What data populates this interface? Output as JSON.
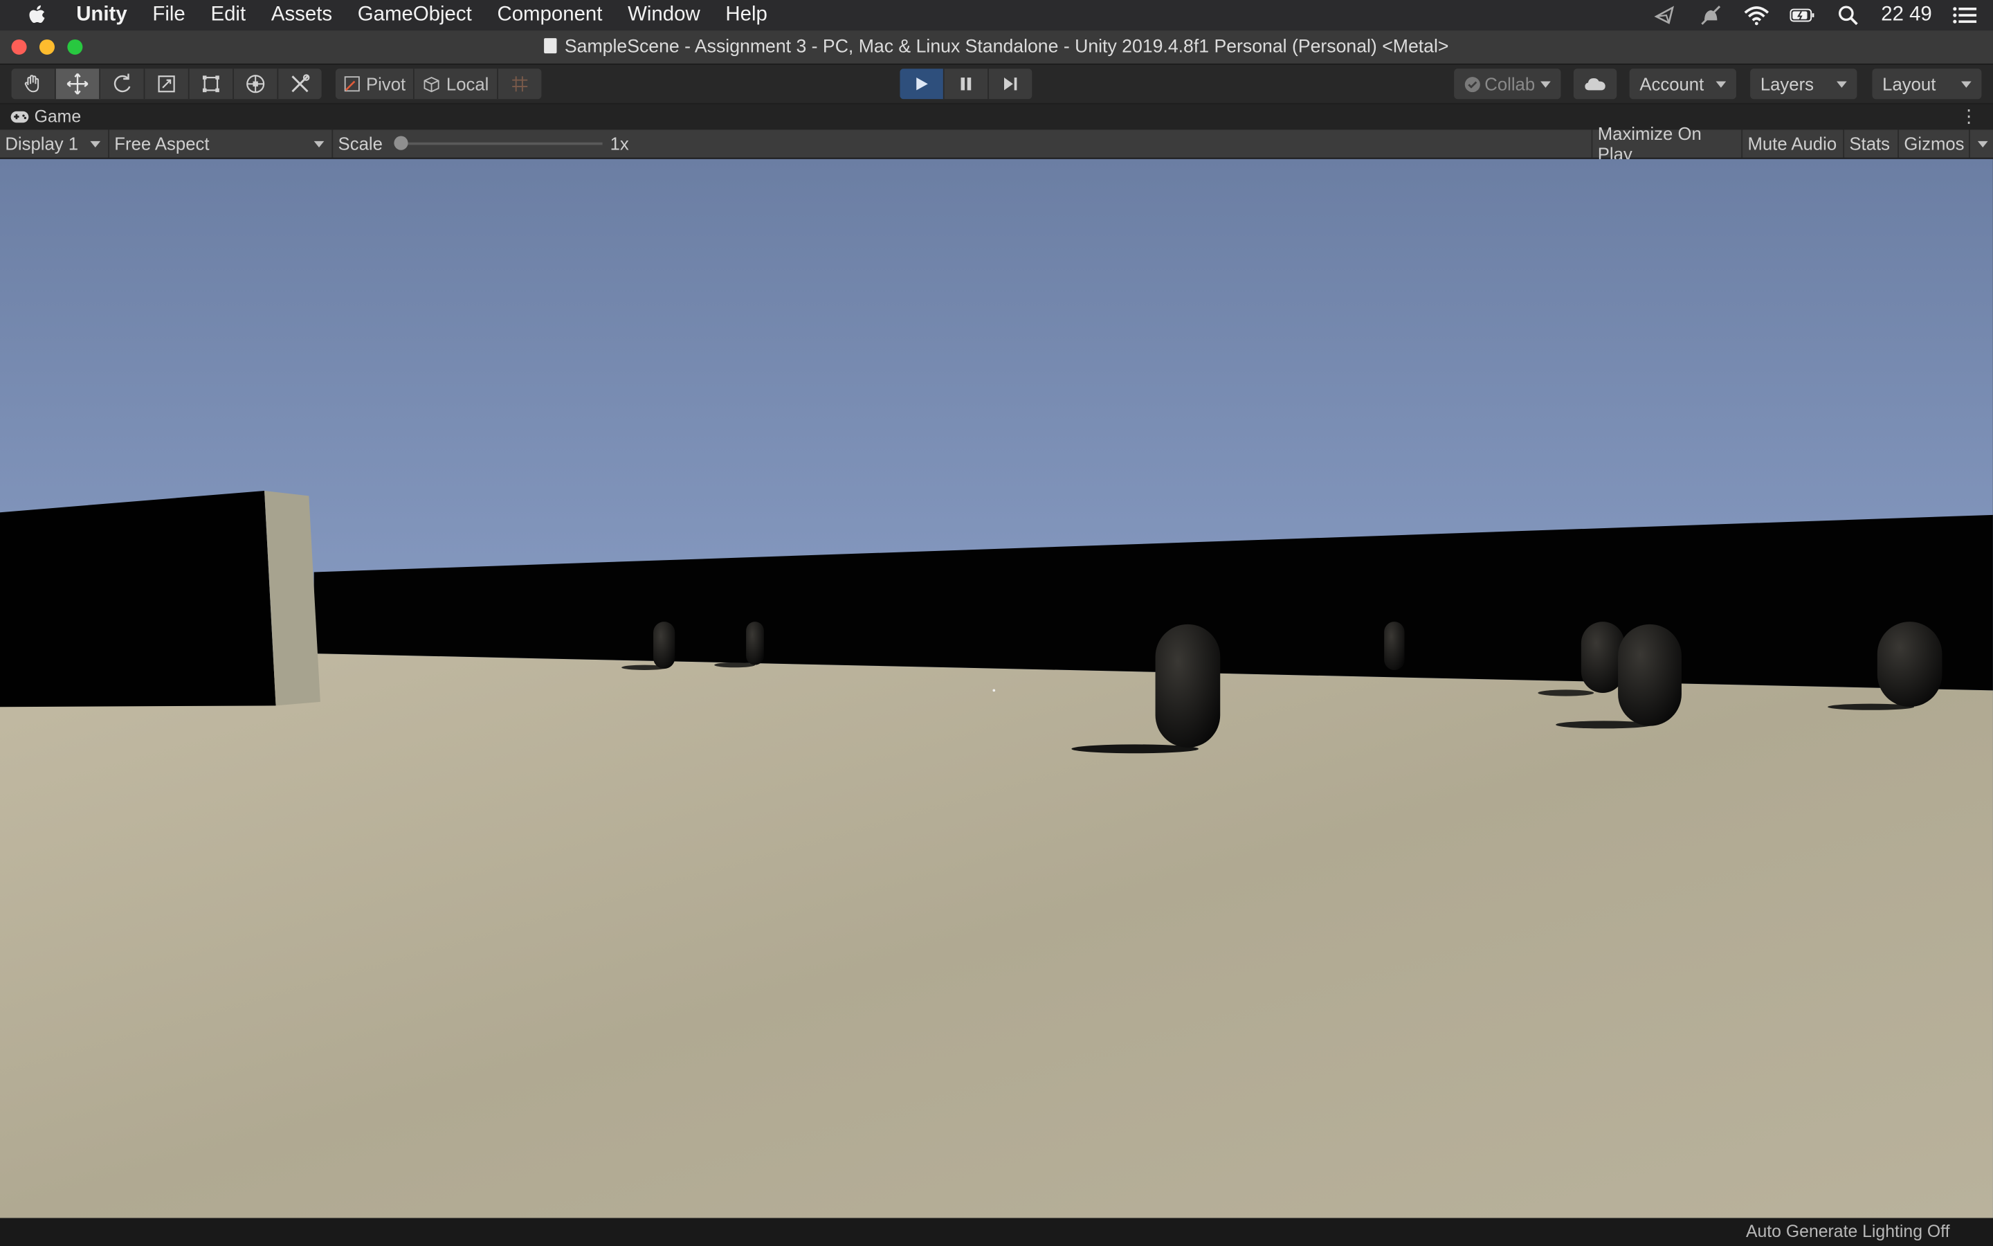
{
  "menubar": {
    "app_name": "Unity",
    "items": [
      "File",
      "Edit",
      "Assets",
      "GameObject",
      "Component",
      "Window",
      "Help"
    ],
    "clock": "22 49"
  },
  "window": {
    "title": "SampleScene - Assignment 3 - PC, Mac & Linux Standalone - Unity 2019.4.8f1 Personal (Personal) <Metal>"
  },
  "toolbar": {
    "tools": [
      "hand-tool",
      "move-tool",
      "rotate-tool",
      "scale-tool",
      "rect-tool",
      "transform-tool",
      "custom-tool"
    ],
    "active_tool": "move-tool",
    "pivot_label": "Pivot",
    "local_label": "Local",
    "collab_label": "Collab",
    "account_label": "Account",
    "layers_label": "Layers",
    "layout_label": "Layout",
    "play_active": true
  },
  "game_view": {
    "tab_label": "Game",
    "display": "Display 1",
    "aspect": "Free Aspect",
    "scale_label": "Scale",
    "scale_value": "1x",
    "maximize_label": "Maximize On Play",
    "mute_label": "Mute Audio",
    "stats_label": "Stats",
    "gizmos_label": "Gizmos"
  },
  "colors": {
    "sky_top": "#6b7ea3",
    "sky_horizon": "#a8bde6",
    "ground": "#b5ae98",
    "wall": "#020202",
    "play_active": "#2e4f7c"
  },
  "status": {
    "message": "Auto Generate Lighting Off"
  }
}
